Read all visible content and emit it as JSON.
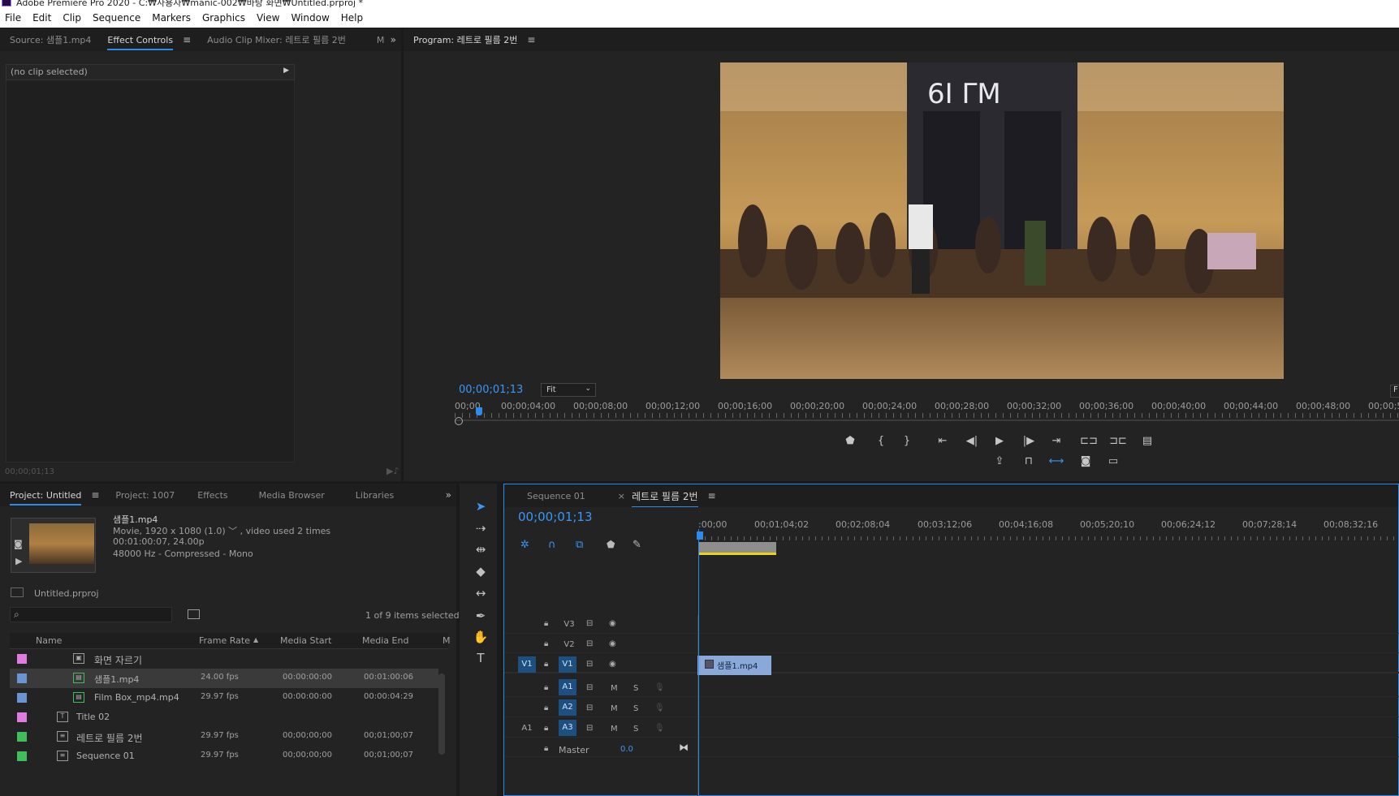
{
  "window": {
    "title": "Adobe Premiere Pro 2020 - C:₩사용자₩manic-002₩바탕 화면₩Untitled.prproj *"
  },
  "menu": [
    "File",
    "Edit",
    "Clip",
    "Sequence",
    "Markers",
    "Graphics",
    "View",
    "Window",
    "Help"
  ],
  "source_panel": {
    "tabs": [
      "Source: 샘플1.mp4",
      "Effect Controls",
      "Audio Clip Mixer: 레트로 필름 2번",
      "M"
    ],
    "no_clip": "(no clip selected)",
    "timecode": "00;00;01;13"
  },
  "program": {
    "title": "Program: 레트로 필름 2번",
    "timecode": "00;00;01;13",
    "fit": "Fit",
    "right_label": "F",
    "ruler": [
      "00;00",
      "00;00;04;00",
      "00;00;08;00",
      "00;00;12;00",
      "00;00;16;00",
      "00;00;20;00",
      "00;00;24;00",
      "00;00;28;00",
      "00;00;32;00",
      "00;00;36;00",
      "00;00;40;00",
      "00;00;44;00",
      "00;00;48;00",
      "00;00;5"
    ]
  },
  "project": {
    "tabs": [
      "Project: Untitled",
      "Project: 1007",
      "Effects",
      "Media Browser",
      "Libraries"
    ],
    "clip": {
      "name": "샘플1.mp4",
      "info1": "Movie, 1920 x 1080 (1.0) ﹀ , video used 2 times",
      "info2": "00:01:00:07, 24.00p",
      "info3": "48000 Hz - Compressed - Mono"
    },
    "file": "Untitled.prproj",
    "items_selected": "1 of 9 items selected",
    "columns": [
      "Name",
      "Frame Rate",
      "Media Start",
      "Media End",
      "M"
    ],
    "rows": [
      {
        "name": "화면 자르기",
        "fps": "",
        "start": "",
        "end": "",
        "color": "#e07ce0"
      },
      {
        "name": "샘플1.mp4",
        "fps": "24.00 fps",
        "start": "00:00:00:00",
        "end": "00:01:00:06",
        "color": "#6a95d2"
      },
      {
        "name": "Film Box_mp4.mp4",
        "fps": "29.97 fps",
        "start": "00:00:00:00",
        "end": "00:00:04:29",
        "color": "#6a95d2"
      },
      {
        "name": "Title 02",
        "fps": "",
        "start": "",
        "end": "",
        "color": "#e07ce0"
      },
      {
        "name": "레트로 필름 2번",
        "fps": "29.97 fps",
        "start": "00;00;00;00",
        "end": "00;01;00;07",
        "color": "#3fbf5a"
      },
      {
        "name": "Sequence 01",
        "fps": "29.97 fps",
        "start": "00;00;00;00",
        "end": "00;01;00;07",
        "color": "#3fbf5a"
      }
    ]
  },
  "timeline": {
    "tabs": [
      "Sequence 01",
      "레트로 필름 2번"
    ],
    "close": "×",
    "timecode": "00;00;01;13",
    "ruler": [
      ":00;00",
      "00;01;04;02",
      "00;02;08;04",
      "00;03;12;06",
      "00;04;16;08",
      "00;05;20;10",
      "00;06;24;12",
      "00;07;28;14",
      "00;08;32;16"
    ],
    "tracks": {
      "v3": "V3",
      "v2": "V2",
      "v1": "V1",
      "a1": "A1",
      "a2": "A2",
      "a3": "A3",
      "src_v": "V1",
      "src_a": "A1",
      "master": "Master",
      "master_val": "0.0",
      "m": "M",
      "s": "S"
    },
    "clip_name": "샘플1.mp4"
  }
}
